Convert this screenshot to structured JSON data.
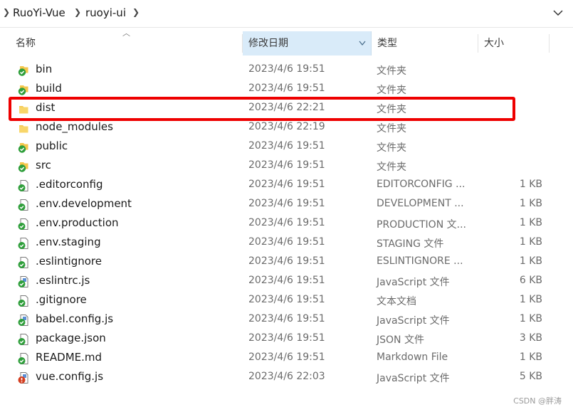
{
  "breadcrumb": [
    "RuoYi-Vue",
    "ruoyi-ui"
  ],
  "columns": {
    "name": "名称",
    "date": "修改日期",
    "type": "类型",
    "size": "大小"
  },
  "files": [
    {
      "name": "bin",
      "date": "2023/4/6 19:51",
      "type": "文件夹",
      "size": "",
      "icon": "folder-synced"
    },
    {
      "name": "build",
      "date": "2023/4/6 19:51",
      "type": "文件夹",
      "size": "",
      "icon": "folder-synced"
    },
    {
      "name": "dist",
      "date": "2023/4/6 22:21",
      "type": "文件夹",
      "size": "",
      "icon": "folder"
    },
    {
      "name": "node_modules",
      "date": "2023/4/6 22:19",
      "type": "文件夹",
      "size": "",
      "icon": "folder"
    },
    {
      "name": "public",
      "date": "2023/4/6 19:51",
      "type": "文件夹",
      "size": "",
      "icon": "folder-synced"
    },
    {
      "name": "src",
      "date": "2023/4/6 19:51",
      "type": "文件夹",
      "size": "",
      "icon": "folder-synced"
    },
    {
      "name": ".editorconfig",
      "date": "2023/4/6 19:51",
      "type": "EDITORCONFIG ...",
      "size": "1 KB",
      "icon": "file-synced"
    },
    {
      "name": ".env.development",
      "date": "2023/4/6 19:51",
      "type": "DEVELOPMENT ...",
      "size": "1 KB",
      "icon": "file-synced"
    },
    {
      "name": ".env.production",
      "date": "2023/4/6 19:51",
      "type": "PRODUCTION 文...",
      "size": "1 KB",
      "icon": "file-synced"
    },
    {
      "name": ".env.staging",
      "date": "2023/4/6 19:51",
      "type": "STAGING 文件",
      "size": "1 KB",
      "icon": "file-synced"
    },
    {
      "name": ".eslintignore",
      "date": "2023/4/6 19:51",
      "type": "ESLINTIGNORE ...",
      "size": "1 KB",
      "icon": "file-synced"
    },
    {
      "name": ".eslintrc.js",
      "date": "2023/4/6 19:51",
      "type": "JavaScript 文件",
      "size": "6 KB",
      "icon": "js-synced"
    },
    {
      "name": ".gitignore",
      "date": "2023/4/6 19:51",
      "type": "文本文档",
      "size": "1 KB",
      "icon": "file-synced"
    },
    {
      "name": "babel.config.js",
      "date": "2023/4/6 19:51",
      "type": "JavaScript 文件",
      "size": "1 KB",
      "icon": "js-synced"
    },
    {
      "name": "package.json",
      "date": "2023/4/6 19:51",
      "type": "JSON 文件",
      "size": "3 KB",
      "icon": "file-synced"
    },
    {
      "name": "README.md",
      "date": "2023/4/6 19:51",
      "type": "Markdown File",
      "size": "1 KB",
      "icon": "md-synced"
    },
    {
      "name": "vue.config.js",
      "date": "2023/4/6 22:03",
      "type": "JavaScript 文件",
      "size": "5 KB",
      "icon": "js-modified"
    }
  ],
  "highlight_row": "dist",
  "watermark": "CSDN @胖涛",
  "colors": {
    "sync_green": "#2e9e3a",
    "folder_yellow": "#f4c64c",
    "modified_red": "#d43d1f",
    "highlight_border": "#ee0000",
    "sorted_header": "#d9ebf9"
  }
}
